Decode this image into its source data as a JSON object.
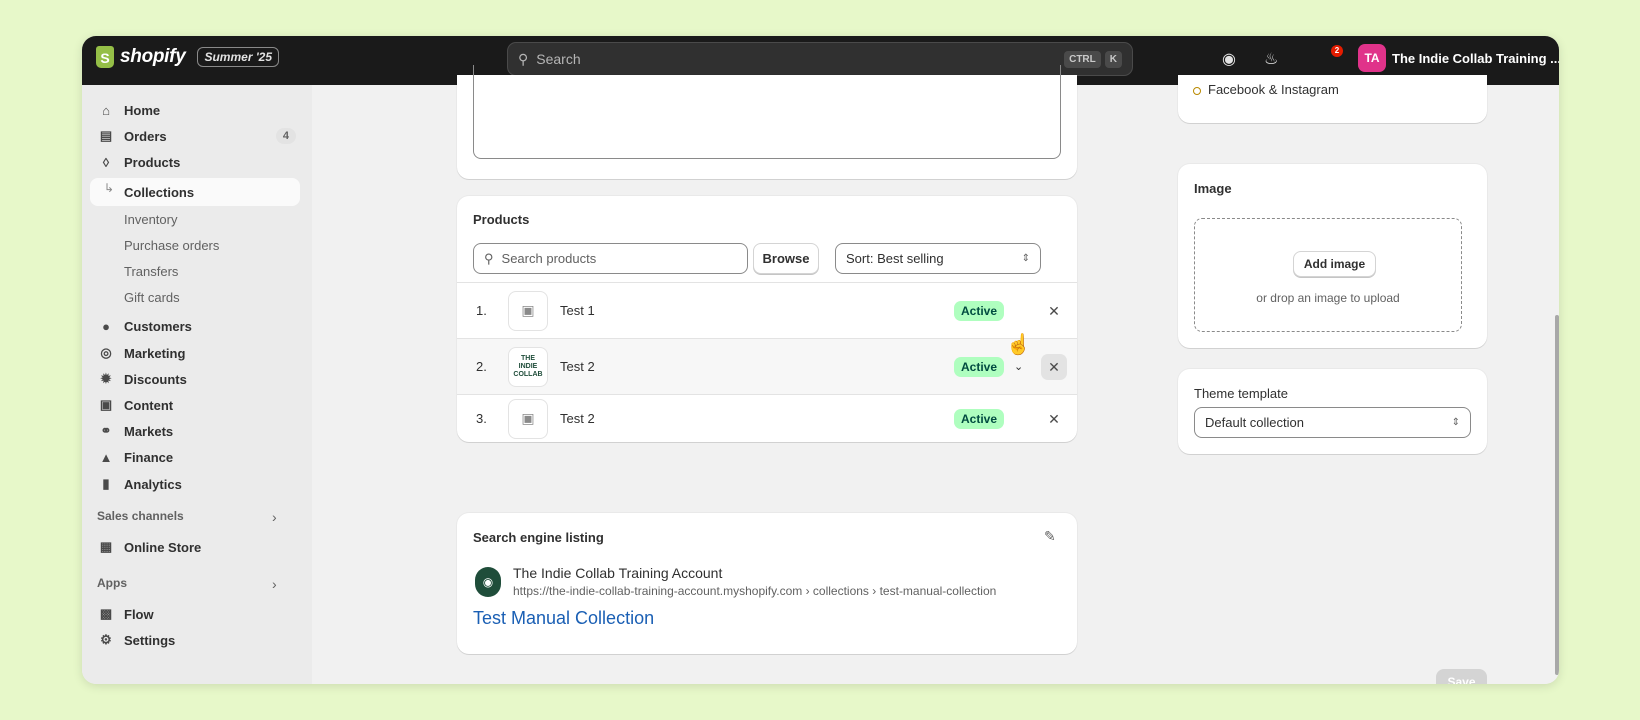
{
  "topbar": {
    "brand": "shopify",
    "edition": "Summer '25",
    "search_placeholder": "Search",
    "kbd_ctrl": "CTRL",
    "kbd_k": "K",
    "notification_count": "2",
    "avatar_initials": "TA",
    "store_name": "The Indie Collab Training ..."
  },
  "sidebar": {
    "home": "Home",
    "orders": "Orders",
    "orders_count": "4",
    "products": "Products",
    "collections": "Collections",
    "inventory": "Inventory",
    "purchase_orders": "Purchase orders",
    "transfers": "Transfers",
    "gift_cards": "Gift cards",
    "customers": "Customers",
    "marketing": "Marketing",
    "discounts": "Discounts",
    "content": "Content",
    "markets": "Markets",
    "finance": "Finance",
    "analytics": "Analytics",
    "sales_channels": "Sales channels",
    "online_store": "Online Store",
    "apps": "Apps",
    "flow": "Flow",
    "settings": "Settings"
  },
  "products": {
    "title": "Products",
    "search_placeholder": "Search products",
    "browse": "Browse",
    "sort": "Sort: Best selling",
    "rows": [
      {
        "num": "1.",
        "name": "Test 1",
        "status": "Active",
        "logo_text": ""
      },
      {
        "num": "2.",
        "name": "Test 2",
        "status": "Active",
        "logo_text": "THE INDIE COLLAB"
      },
      {
        "num": "3.",
        "name": "Test 2",
        "status": "Active",
        "logo_text": ""
      }
    ]
  },
  "seo": {
    "title": "Search engine listing",
    "store": "The Indie Collab Training Account",
    "url": "https://the-indie-collab-training-account.myshopify.com › collections › test-manual-collection",
    "page_title": "Test Manual Collection"
  },
  "right": {
    "channel": "Facebook & Instagram",
    "image_title": "Image",
    "add_image": "Add image",
    "drop_hint": "or drop an image to upload",
    "theme_title": "Theme template",
    "theme_value": "Default collection"
  },
  "save": "Save"
}
